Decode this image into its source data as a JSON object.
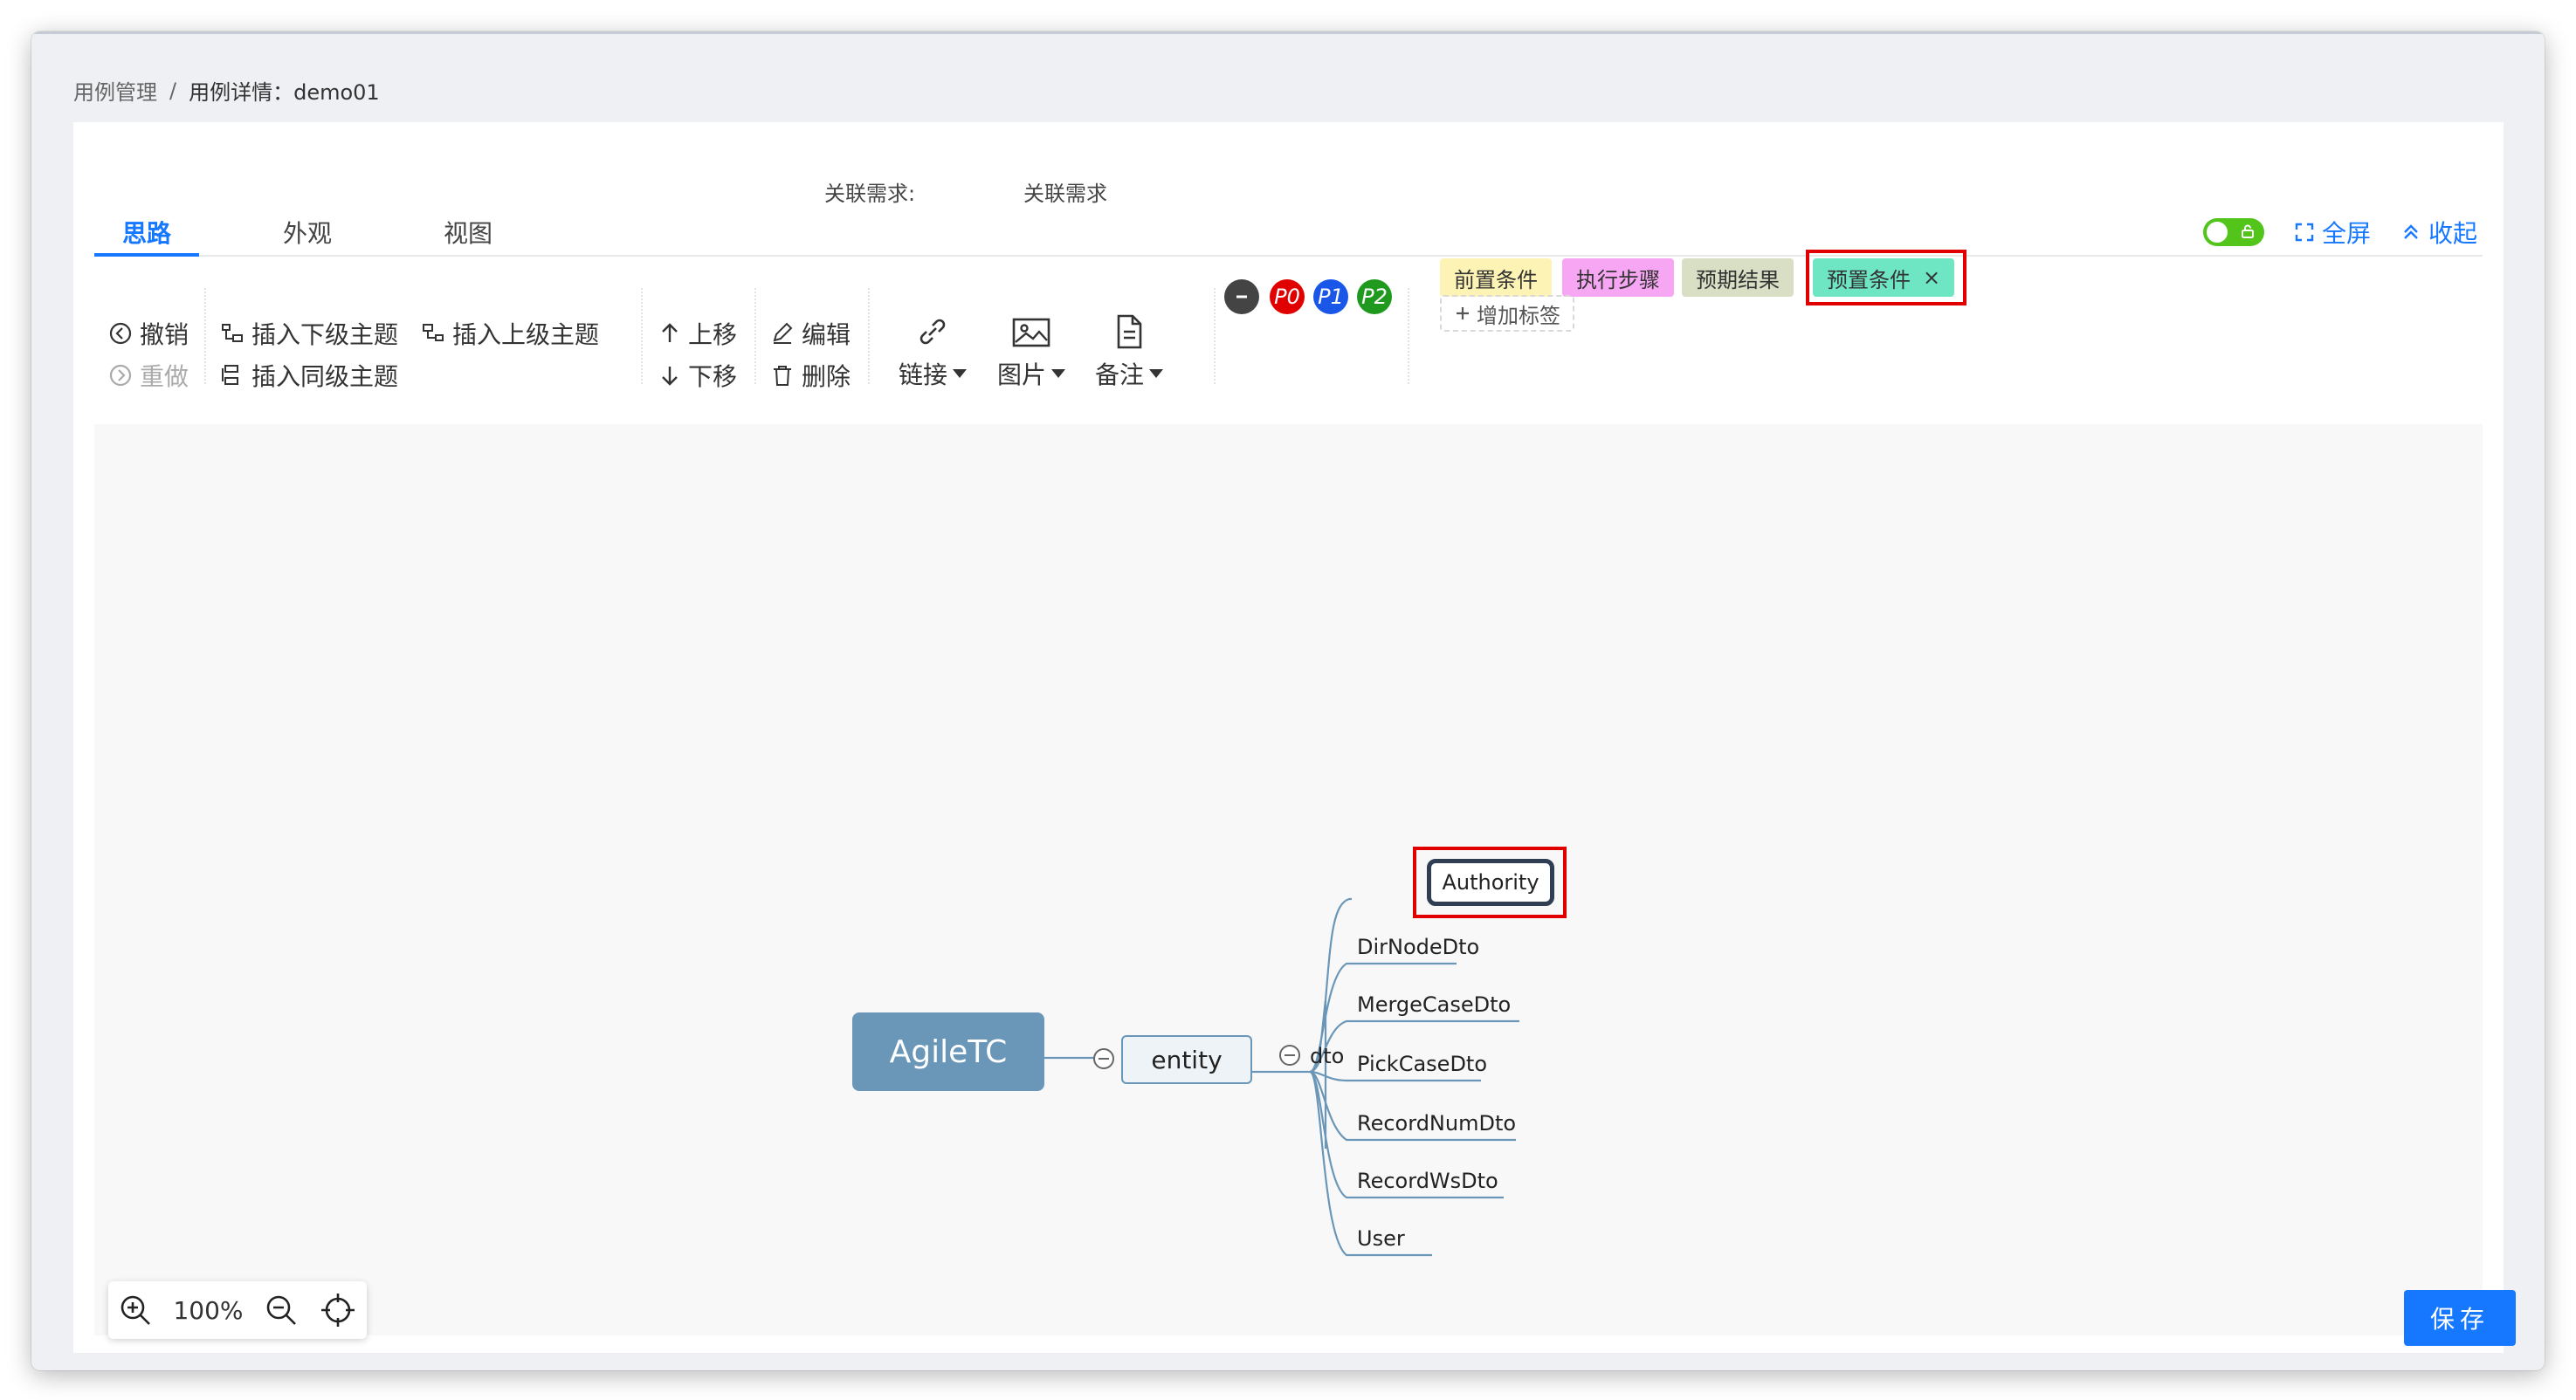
{
  "breadcrumb": {
    "parent": "用例管理",
    "separator": "/",
    "current": "用例详情：demo01"
  },
  "related": {
    "label": "关联需求:",
    "value": "关联需求"
  },
  "tabs": [
    {
      "label": "思路",
      "active": true
    },
    {
      "label": "外观",
      "active": false
    },
    {
      "label": "视图",
      "active": false
    }
  ],
  "top_actions": {
    "fullscreen": "全屏",
    "collapse": "收起",
    "toggle_on": true
  },
  "toolbar": {
    "undo": "撤销",
    "redo": "重做",
    "insert_child": "插入下级主题",
    "insert_parent": "插入上级主题",
    "insert_sibling": "插入同级主题",
    "move_up": "上移",
    "move_down": "下移",
    "edit": "编辑",
    "delete": "删除",
    "link": "链接",
    "image": "图片",
    "note": "备注"
  },
  "priorities": [
    {
      "label": "P0",
      "color": "#e00000"
    },
    {
      "label": "P1",
      "color": "#1a56e8"
    },
    {
      "label": "P2",
      "color": "#1f9a1f"
    }
  ],
  "tags": [
    {
      "label": "前置条件",
      "color": "#fdf3b4"
    },
    {
      "label": "执行步骤",
      "color": "#f6a6f2"
    },
    {
      "label": "预期结果",
      "color": "#d9dfc4"
    },
    {
      "label": "预置条件",
      "color": "#6ee6c4",
      "closable": true,
      "close": "×"
    }
  ],
  "add_tag": "增加标签",
  "mindmap": {
    "root": "AgileTC",
    "level1": "entity",
    "level2": "dto",
    "children": [
      "Authority",
      "DirNodeDto",
      "MergeCaseDto",
      "PickCaseDto",
      "RecordNumDto",
      "RecordWsDto",
      "User"
    ],
    "selected": "Authority"
  },
  "zoom": {
    "value": "100%"
  },
  "save": "保存"
}
